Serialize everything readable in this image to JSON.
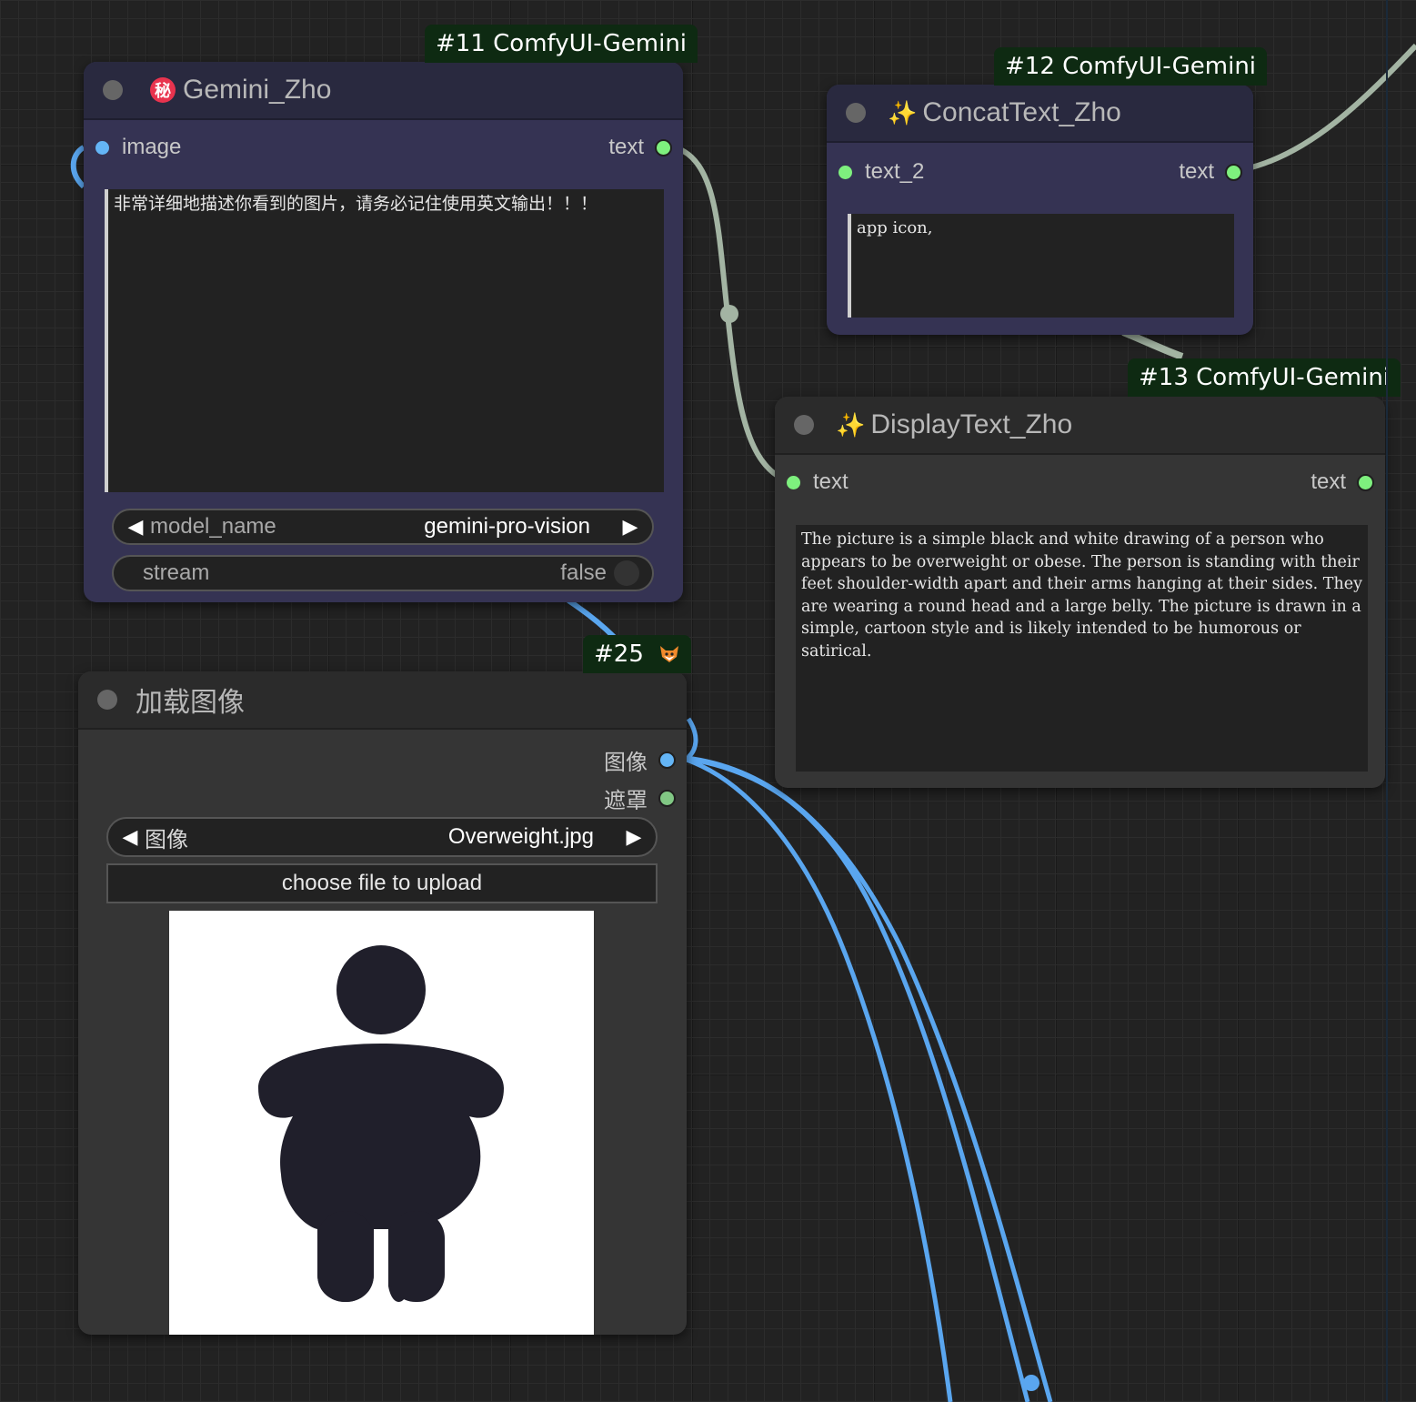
{
  "nodes": {
    "gemini": {
      "badge": "#11 ComfyUI-Gemini",
      "badge_icon": "hanko-secret-icon",
      "badge_glyph": "秘",
      "title": "Gemini_Zho",
      "input_label": "image",
      "output_label": "text",
      "prompt": "非常详细地描述你看到的图片，请务必记住使用英文输出！！！",
      "model_label": "model_name",
      "model_value": "gemini-pro-vision",
      "stream_label": "stream",
      "stream_value": "false"
    },
    "concat": {
      "badge": "#12 ComfyUI-Gemini",
      "title_emoji": "✨",
      "title": "ConcatText_Zho",
      "input_label": "text_2",
      "output_label": "text",
      "text": "app icon,"
    },
    "display": {
      "badge": "#13 ComfyUI-Gemini",
      "title_emoji": "✨",
      "title": "DisplayText_Zho",
      "input_label": "text",
      "output_label": "text",
      "text": "The picture is a simple black and white drawing of a person who appears to be overweight or obese. The person is standing with their feet shoulder-width apart and their arms hanging at their sides. They are wearing a round head and a large belly. The picture is drawn in a simple, cartoon style and is likely intended to be humorous or satirical."
    },
    "load_image": {
      "badge": "#25",
      "badge_icon": "fox-icon",
      "title": "加载图像",
      "output_image_label": "图像",
      "output_mask_label": "遮罩",
      "image_label": "图像",
      "image_value": "Overweight.jpg",
      "upload_label": "choose file to upload"
    }
  },
  "colors": {
    "image_wire": "#5aa6ef",
    "text_wire": "#a3b4a3",
    "text_slot": "#7ef07e",
    "image_slot": "#64b5f6",
    "mask_slot": "#81c784",
    "badge_bg": "#0e2a12",
    "purple_node": "#353353",
    "gray_node": "#353535"
  }
}
